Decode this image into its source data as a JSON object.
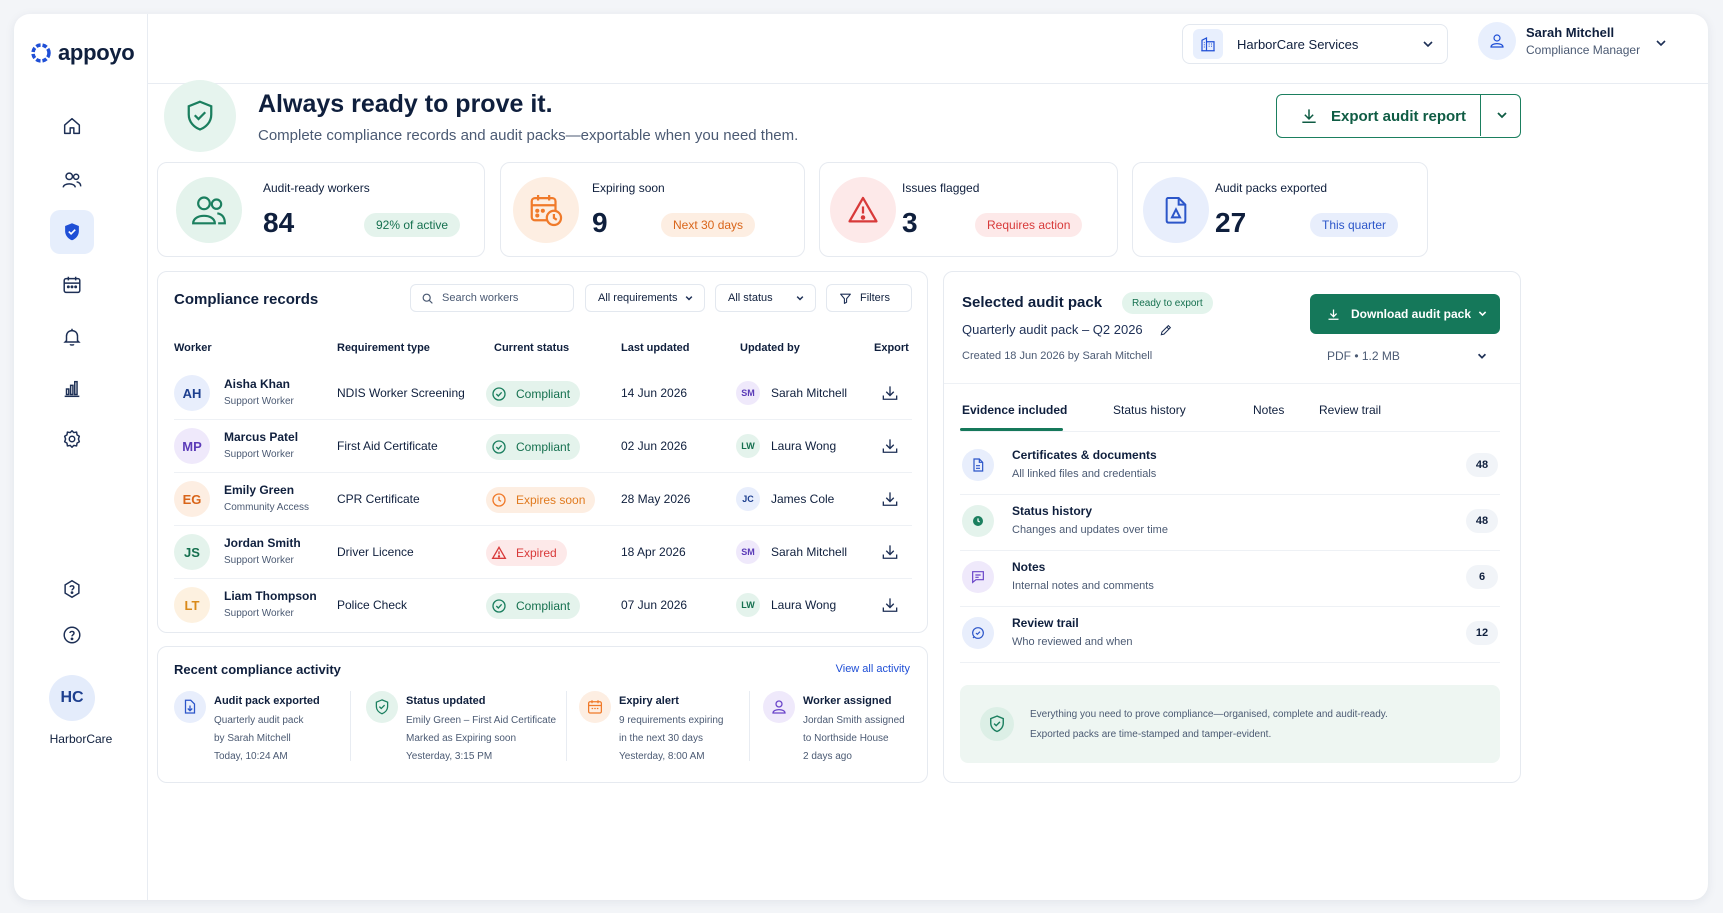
{
  "brand": {
    "logo_text": "appoyo"
  },
  "sidebar": {
    "items": [
      {
        "name": "home"
      },
      {
        "name": "workers"
      },
      {
        "name": "compliance",
        "active": true
      },
      {
        "name": "calendar"
      },
      {
        "name": "notifications"
      },
      {
        "name": "reports"
      },
      {
        "name": "settings"
      },
      {
        "name": "help-settings"
      },
      {
        "name": "help"
      }
    ],
    "org_initials": "HC",
    "org_label": "HarborCare"
  },
  "topbar": {
    "org_name": "HarborCare Services",
    "user_name": "Sarah Mitchell",
    "user_role": "Compliance Manager"
  },
  "hero": {
    "title": "Always ready to prove it.",
    "subtitle": "Complete compliance records and audit packs—exportable when you need them.",
    "export_label": "Export audit report"
  },
  "stats": [
    {
      "label": "Audit-ready workers",
      "value": "84",
      "pill": "92% of active",
      "color": "#1b7f5f"
    },
    {
      "label": "Expiring soon",
      "value": "9",
      "pill": "Next 30 days",
      "color": "#f07a2a"
    },
    {
      "label": "Issues flagged",
      "value": "3",
      "pill": "Requires action",
      "color": "#d83a3a"
    },
    {
      "label": "Audit packs exported",
      "value": "27",
      "pill": "This quarter",
      "color": "#2c56c9"
    }
  ],
  "records": {
    "title": "Compliance records",
    "search_placeholder": "Search workers",
    "filter_requirements": "All requirements",
    "filter_status": "All status",
    "filters_label": "Filters",
    "columns": [
      "Worker",
      "Requirement type",
      "Current status",
      "Last updated",
      "Updated by",
      "Export"
    ],
    "rows": [
      {
        "initials": "AH",
        "name": "Aisha Khan",
        "role": "Support Worker",
        "requirement": "NDIS Worker Screening",
        "status": "Compliant",
        "status_kind": "ok",
        "date": "14 Jun 2026",
        "by_initials": "SM",
        "by": "Sarah Mitchell"
      },
      {
        "initials": "MP",
        "name": "Marcus Patel",
        "role": "Support Worker",
        "requirement": "First Aid Certificate",
        "status": "Compliant",
        "status_kind": "ok",
        "date": "02 Jun 2026",
        "by_initials": "LW",
        "by": "Laura Wong"
      },
      {
        "initials": "EG",
        "name": "Emily Green",
        "role": "Community Access",
        "requirement": "CPR Certificate",
        "status": "Expires soon",
        "status_kind": "warn",
        "date": "28 May 2026",
        "by_initials": "JC",
        "by": "James Cole"
      },
      {
        "initials": "JS",
        "name": "Jordan Smith",
        "role": "Support Worker",
        "requirement": "Driver Licence",
        "status": "Expired",
        "status_kind": "bad",
        "date": "18 Apr 2026",
        "by_initials": "SM",
        "by": "Sarah Mitchell"
      },
      {
        "initials": "LT",
        "name": "Liam Thompson",
        "role": "Support Worker",
        "requirement": "Police Check",
        "status": "Compliant",
        "status_kind": "ok",
        "date": "07 Jun 2026",
        "by_initials": "LW",
        "by": "Laura Wong"
      }
    ]
  },
  "activity": {
    "title": "Recent compliance activity",
    "view_all": "View all activity",
    "items": [
      {
        "title": "Audit pack exported",
        "lines": [
          "Quarterly audit pack",
          "by Sarah Mitchell",
          "Today, 10:24 AM"
        ]
      },
      {
        "title": "Status updated",
        "lines": [
          "Emily Green – First Aid Certificate",
          "Marked as Expiring soon",
          "Yesterday, 3:15 PM"
        ]
      },
      {
        "title": "Expiry alert",
        "lines": [
          "9 requirements expiring",
          "in the next 30 days",
          "Yesterday, 8:00 AM"
        ]
      },
      {
        "title": "Worker assigned",
        "lines": [
          "Jordan Smith assigned",
          "to Northside House",
          "2 days ago"
        ]
      }
    ]
  },
  "audit_pack": {
    "title": "Selected audit pack",
    "badge": "Ready to export",
    "pack_name": "Quarterly audit pack – Q2 2026",
    "created": "Created 18 Jun 2026 by Sarah Mitchell",
    "download_label": "Download audit pack",
    "file_info": "PDF • 1.2 MB",
    "tabs": [
      "Evidence included",
      "Status history",
      "Notes",
      "Review trail"
    ],
    "evidence": [
      {
        "title": "Certificates & documents",
        "subtitle": "All linked files and credentials",
        "count": "48"
      },
      {
        "title": "Status history",
        "subtitle": "Changes and updates over time",
        "count": "48"
      },
      {
        "title": "Notes",
        "subtitle": "Internal notes and comments",
        "count": "6"
      },
      {
        "title": "Review trail",
        "subtitle": "Who reviewed and when",
        "count": "12"
      }
    ],
    "info_line1": "Everything you need to prove compliance—organised, complete and audit-ready.",
    "info_line2": "Exported packs are time-stamped and tamper-evident."
  }
}
